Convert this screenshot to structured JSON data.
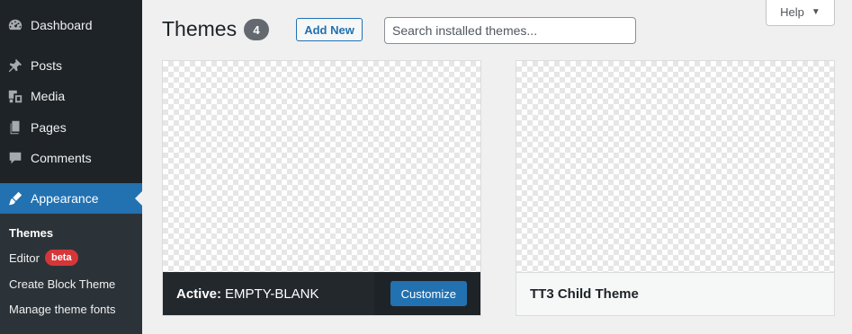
{
  "sidebar": {
    "items": [
      {
        "label": "Dashboard",
        "icon": "dashboard-icon"
      },
      {
        "label": "Posts",
        "icon": "pin-icon"
      },
      {
        "label": "Media",
        "icon": "media-icon"
      },
      {
        "label": "Pages",
        "icon": "pages-icon"
      },
      {
        "label": "Comments",
        "icon": "comment-icon"
      },
      {
        "label": "Appearance",
        "icon": "brush-icon"
      }
    ],
    "submenu": [
      {
        "label": "Themes"
      },
      {
        "label": "Editor",
        "badge": "beta"
      },
      {
        "label": "Create Block Theme"
      },
      {
        "label": "Manage theme fonts"
      }
    ]
  },
  "header": {
    "title": "Themes",
    "count": "4",
    "add_new_label": "Add New",
    "search_placeholder": "Search installed themes...",
    "help_label": "Help"
  },
  "themes": [
    {
      "name": "EMPTY-BLANK",
      "active_label": "Active:",
      "customize_label": "Customize",
      "active": true
    },
    {
      "name": "TT3 Child Theme",
      "active": false
    }
  ],
  "colors": {
    "accent": "#2271b1",
    "sidebar_bg": "#1d2327",
    "badge": "#d63638"
  }
}
